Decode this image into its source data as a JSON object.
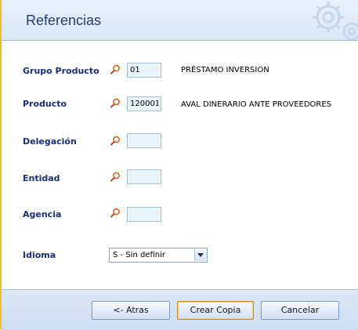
{
  "header": {
    "title": "Referencias",
    "icon": "gear-icon"
  },
  "form": {
    "grupo_producto": {
      "label": "Grupo Producto",
      "value": "01",
      "description": "PRÉSTAMO INVERSION"
    },
    "producto": {
      "label": "Producto",
      "value": "120001",
      "description": "AVAL DINERARIO ANTE PROVEEDORES"
    },
    "delegacion": {
      "label": "Delegación",
      "value": ""
    },
    "entidad": {
      "label": "Entidad",
      "value": ""
    },
    "agencia": {
      "label": "Agencia",
      "value": ""
    },
    "idioma": {
      "label": "Idioma",
      "selected": "S - Sin definir"
    }
  },
  "footer": {
    "back_label": "<-  Atras",
    "copy_label": "Crear Copia",
    "cancel_label": "Cancelar"
  },
  "colors": {
    "label": "#1a2d7a",
    "accent_stripe": "#f0c020",
    "field_bg": "#e8f3fb",
    "search_icon": "#d2691e"
  }
}
